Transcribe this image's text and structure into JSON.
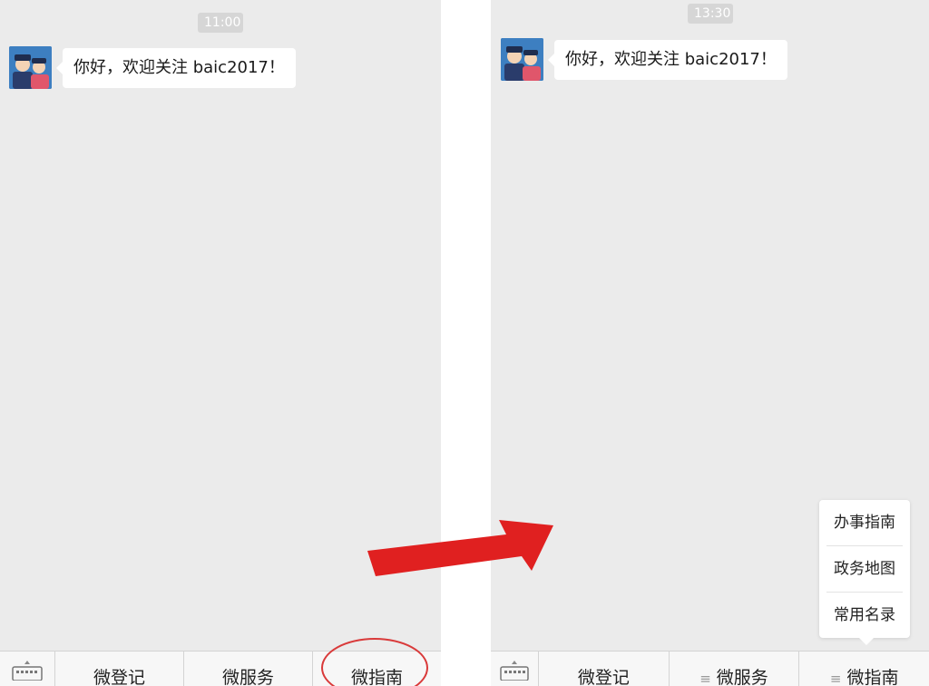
{
  "left_screen": {
    "timestamp": "11:00",
    "message": "你好，欢迎关注 baic2017！",
    "menu": [
      "微登记",
      "微服务",
      "微指南"
    ]
  },
  "right_screen": {
    "timestamp": "13:30",
    "message": "你好，欢迎关注 baic2017！",
    "menu": [
      "微登记",
      "微服务",
      "微指南"
    ],
    "submenu": [
      "办事指南",
      "政务地图",
      "常用名录"
    ]
  },
  "colors": {
    "chat_background": "#ebebeb",
    "bubble": "#ffffff",
    "annotation_red": "#e02020"
  },
  "icons": [
    "keyboard-icon",
    "avatar-police-image",
    "menu-lines-icon",
    "red-arrow-annotation"
  ]
}
